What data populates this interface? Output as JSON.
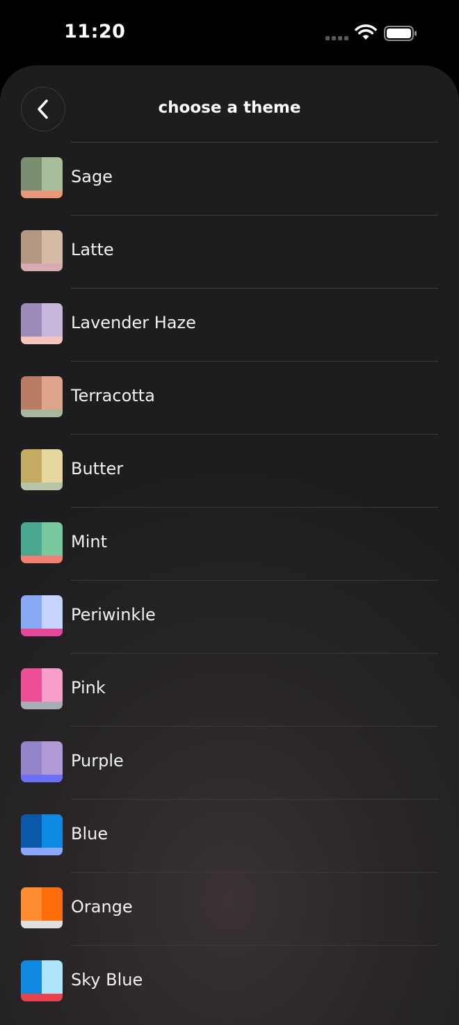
{
  "status_bar": {
    "time": "11:20"
  },
  "header": {
    "title": "choose a theme",
    "back_icon": "chevron-left-icon"
  },
  "themes": [
    {
      "name": "Sage",
      "colors": [
        "#7b8e6f",
        "#a8bd9a",
        "#e8977a"
      ]
    },
    {
      "name": "Latte",
      "colors": [
        "#b39783",
        "#d5bba6",
        "#d9aab0"
      ]
    },
    {
      "name": "Lavender Haze",
      "colors": [
        "#9d8bbb",
        "#c8b7dd",
        "#f5c4bd"
      ]
    },
    {
      "name": "Terracotta",
      "colors": [
        "#b97b62",
        "#dea58b",
        "#a8b89c"
      ]
    },
    {
      "name": "Butter",
      "colors": [
        "#c4ab62",
        "#e6d79e",
        "#b8c4a8"
      ]
    },
    {
      "name": "Mint",
      "colors": [
        "#4aa890",
        "#79c79e",
        "#f07f72"
      ]
    },
    {
      "name": "Periwinkle",
      "colors": [
        "#8aaaf5",
        "#c6d3fb",
        "#e8489a"
      ]
    },
    {
      "name": "Pink",
      "colors": [
        "#ef4f99",
        "#f79fca",
        "#a7adb2"
      ]
    },
    {
      "name": "Purple",
      "colors": [
        "#9484c9",
        "#b29ad6",
        "#6b70f5"
      ]
    },
    {
      "name": "Blue",
      "colors": [
        "#0a59a8",
        "#0f8ae4",
        "#8ca6fb"
      ]
    },
    {
      "name": "Orange",
      "colors": [
        "#ff8c2e",
        "#ff6d0a",
        "#e0e0e0"
      ]
    },
    {
      "name": "Sky Blue",
      "colors": [
        "#0f8ae0",
        "#aee5fb",
        "#e8434d"
      ]
    }
  ]
}
